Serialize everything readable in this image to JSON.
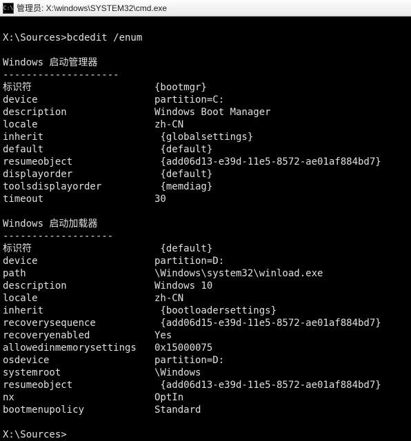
{
  "window": {
    "title": "管理员: X:\\windows\\SYSTEM32\\cmd.exe"
  },
  "prompt1": "X:\\Sources>bcdedit /enum",
  "section1": {
    "title": "Windows 启动管理器",
    "divider": "--------------------",
    "entries": [
      {
        "k": "标识符",
        "v": "{bootmgr}"
      },
      {
        "k": "device",
        "v": "partition=C:"
      },
      {
        "k": "description",
        "v": "Windows Boot Manager"
      },
      {
        "k": "locale",
        "v": "zh-CN"
      },
      {
        "k": "inherit",
        "v": " {globalsettings}"
      },
      {
        "k": "default",
        "v": " {default}"
      },
      {
        "k": "resumeobject",
        "v": " {add06d13-e39d-11e5-8572-ae01af884bd7}"
      },
      {
        "k": "displayorder",
        "v": " {default}"
      },
      {
        "k": "toolsdisplayorder",
        "v": " {memdiag}"
      },
      {
        "k": "timeout",
        "v": "30"
      }
    ]
  },
  "section2": {
    "title": "Windows 启动加载器",
    "divider": "-------------------",
    "entries": [
      {
        "k": "标识符",
        "v": " {default}"
      },
      {
        "k": "device",
        "v": "partition=D:"
      },
      {
        "k": "path",
        "v": "\\Windows\\system32\\winload.exe"
      },
      {
        "k": "description",
        "v": "Windows 10"
      },
      {
        "k": "locale",
        "v": "zh-CN"
      },
      {
        "k": "inherit",
        "v": " {bootloadersettings}"
      },
      {
        "k": "recoverysequence",
        "v": " {add06d15-e39d-11e5-8572-ae01af884bd7}"
      },
      {
        "k": "recoveryenabled",
        "v": "Yes"
      },
      {
        "k": "allowedinmemorysettings",
        "v": "0x15000075"
      },
      {
        "k": "osdevice",
        "v": "partition=D:"
      },
      {
        "k": "systemroot",
        "v": "\\Windows"
      },
      {
        "k": "resumeobject",
        "v": " {add06d13-e39d-11e5-8572-ae01af884bd7}"
      },
      {
        "k": "nx",
        "v": "OptIn"
      },
      {
        "k": "bootmenupolicy",
        "v": "Standard"
      }
    ]
  },
  "prompt2": "X:\\Sources>"
}
